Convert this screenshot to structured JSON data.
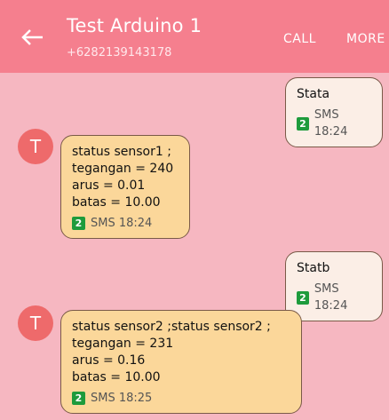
{
  "header": {
    "title": "Test Arduino 1",
    "phone": "+6282139143178",
    "call_label": "CALL",
    "more_label": "MORE"
  },
  "messages": [
    {
      "direction": "out",
      "lines": [
        "Stata"
      ],
      "sim": "2",
      "meta": "SMS 18:24"
    },
    {
      "direction": "in",
      "avatar": "T",
      "lines": [
        "status sensor1 ;",
        "tegangan = 240",
        "arus = 0.01",
        "batas = 10.00"
      ],
      "sim": "2",
      "meta": "SMS 18:24"
    },
    {
      "direction": "out",
      "lines": [
        "Statb"
      ],
      "sim": "2",
      "meta": "SMS 18:24"
    },
    {
      "direction": "in",
      "avatar": "T",
      "lines": [
        "status sensor2 ;status sensor2 ;",
        "tegangan = 231",
        "arus = 0.16",
        "batas = 10.00"
      ],
      "sim": "2",
      "meta": "SMS 18:25"
    }
  ],
  "colors": {
    "app_bar": "#f57f8e",
    "background": "#f6b7c1",
    "incoming_bubble": "#fbd79a",
    "outgoing_bubble": "#fbeee6",
    "avatar": "#ee6a6b",
    "sim_badge": "#1e9b3c"
  }
}
